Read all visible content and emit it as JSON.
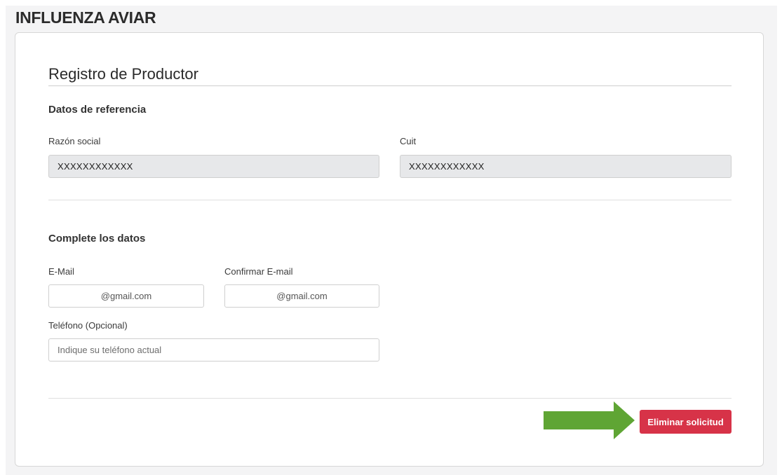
{
  "app": {
    "title": "INFLUENZA AVIAR"
  },
  "form": {
    "title": "Registro de Productor",
    "reference_section": {
      "title": "Datos de referencia",
      "razon_social": {
        "label": "Razón social",
        "value": "XXXXXXXXXXXX"
      },
      "cuit": {
        "label": "Cuit",
        "value": "XXXXXXXXXXXX"
      }
    },
    "complete_section": {
      "title": "Complete los datos",
      "email": {
        "label": "E-Mail",
        "value": "@gmail.com"
      },
      "confirm_email": {
        "label": "Confirmar E-mail",
        "value": "@gmail.com"
      },
      "phone": {
        "label": "Teléfono (Opcional)",
        "placeholder": "Indique su teléfono actual"
      }
    },
    "actions": {
      "delete_label": "Eliminar solicitud"
    }
  },
  "colors": {
    "danger": "#d73348",
    "arrow": "#5fa534",
    "readonly_bg": "#e7e8ea"
  }
}
